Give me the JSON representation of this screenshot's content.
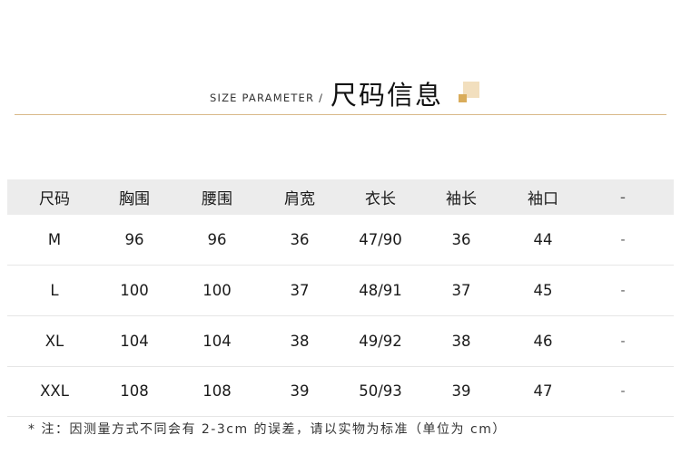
{
  "header": {
    "subtitle": "SIZE PARAMETER /",
    "title": "尺码信息",
    "colors": {
      "rule": "#d9b98a",
      "deco_light": "#f2dfbe",
      "deco_dark": "#d9ac5a"
    }
  },
  "table": {
    "columns": [
      "尺码",
      "胸围",
      "腰围",
      "肩宽",
      "衣长",
      "袖长",
      "袖口",
      "-"
    ],
    "rows": [
      [
        "M",
        "96",
        "96",
        "36",
        "47/90",
        "36",
        "44",
        "-"
      ],
      [
        "L",
        "100",
        "100",
        "37",
        "48/91",
        "37",
        "45",
        "-"
      ],
      [
        "XL",
        "104",
        "104",
        "38",
        "49/92",
        "38",
        "46",
        "-"
      ],
      [
        "XXL",
        "108",
        "108",
        "39",
        "50/93",
        "39",
        "47",
        "-"
      ]
    ]
  },
  "note": "* 注：因测量方式不同会有 2-3cm 的误差，请以实物为标准（单位为 cm）"
}
